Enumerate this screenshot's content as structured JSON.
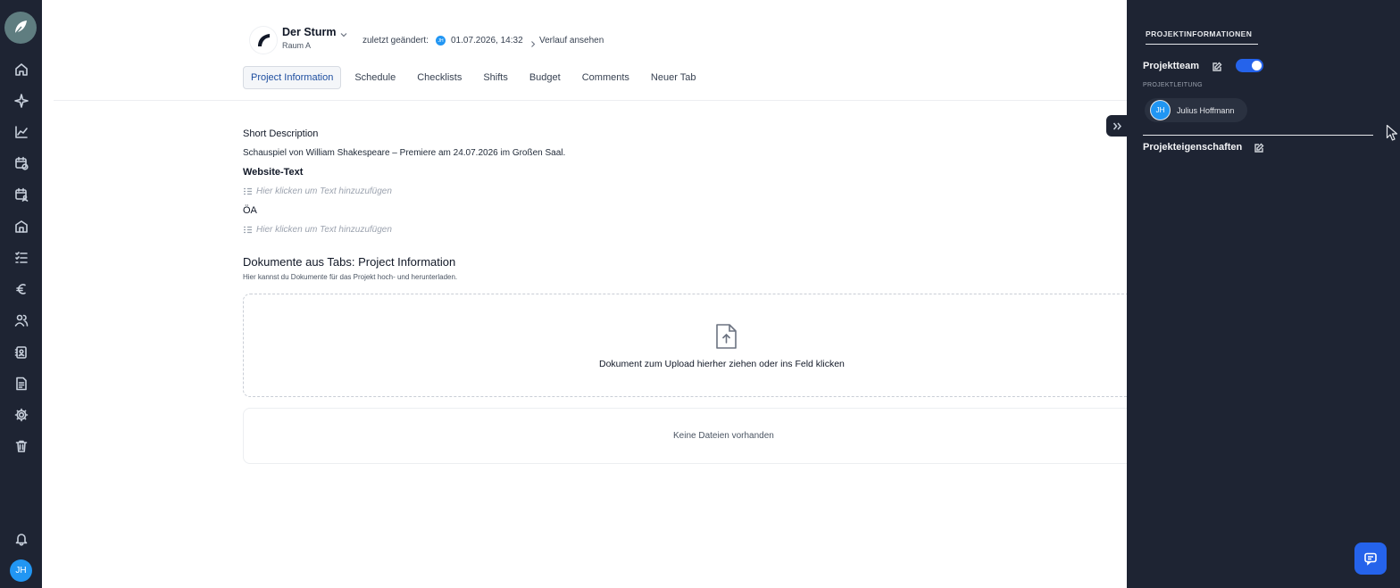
{
  "app": {
    "logo_icon": "feather-logo-icon"
  },
  "nav": {
    "items": [
      {
        "icon": "home-icon"
      },
      {
        "icon": "sparkle-icon"
      },
      {
        "icon": "chart-icon"
      },
      {
        "icon": "calendar-clock-icon"
      },
      {
        "icon": "calendar-user-icon"
      },
      {
        "icon": "building-icon"
      },
      {
        "icon": "checklist-icon"
      },
      {
        "icon": "euro-icon"
      },
      {
        "icon": "users-icon"
      },
      {
        "icon": "contacts-icon"
      },
      {
        "icon": "document-icon"
      },
      {
        "icon": "gear-icon"
      },
      {
        "icon": "trash-icon"
      }
    ],
    "bell_icon": "bell-icon",
    "user_initials": "JH"
  },
  "project": {
    "name": "Der Sturm",
    "room": "Raum A",
    "changed_label": "zuletzt geändert:",
    "changed_initials": "JH",
    "changed_date": "01.07.2026, 14:32",
    "history_link": "Verlauf ansehen"
  },
  "tabs": [
    {
      "label": "Project Information",
      "active": true
    },
    {
      "label": "Schedule",
      "active": false
    },
    {
      "label": "Checklists",
      "active": false
    },
    {
      "label": "Shifts",
      "active": false
    },
    {
      "label": "Budget",
      "active": false
    },
    {
      "label": "Comments",
      "active": false
    },
    {
      "label": "Neuer Tab",
      "active": false
    }
  ],
  "fields": {
    "short_description_label": "Short Description",
    "short_description_value": "Schauspiel von William Shakespeare – Premiere am 24.07.2026 im Großen Saal.",
    "website_text_label": "Website-Text",
    "website_text_placeholder": "Hier klicken um Text hinzuzufügen",
    "oa_label": "ÖA",
    "oa_placeholder": "Hier klicken um Text hinzuzufügen"
  },
  "documents": {
    "title": "Dokumente aus Tabs: Project Information",
    "subtitle": "Hier kannst du Dokumente für das Projekt hoch- und herunterladen.",
    "dropzone_text": "Dokument zum Upload hierher ziehen oder ins Feld klicken",
    "empty_text": "Keine Dateien vorhanden"
  },
  "panel": {
    "tab_label": "PROJEKTINFORMATIONEN",
    "team_heading": "Projektteam",
    "team_toggle_on": true,
    "lead_label": "PROJEKTLEITUNG",
    "lead_member": {
      "initials": "JH",
      "name": "Julius Hoffmann"
    },
    "properties_heading": "Projekteigenschaften"
  },
  "colors": {
    "rail_bg": "#1e2433",
    "accent": "#2563eb",
    "avatar": "#2196f3",
    "active_tab_text": "#1f4fa0"
  }
}
